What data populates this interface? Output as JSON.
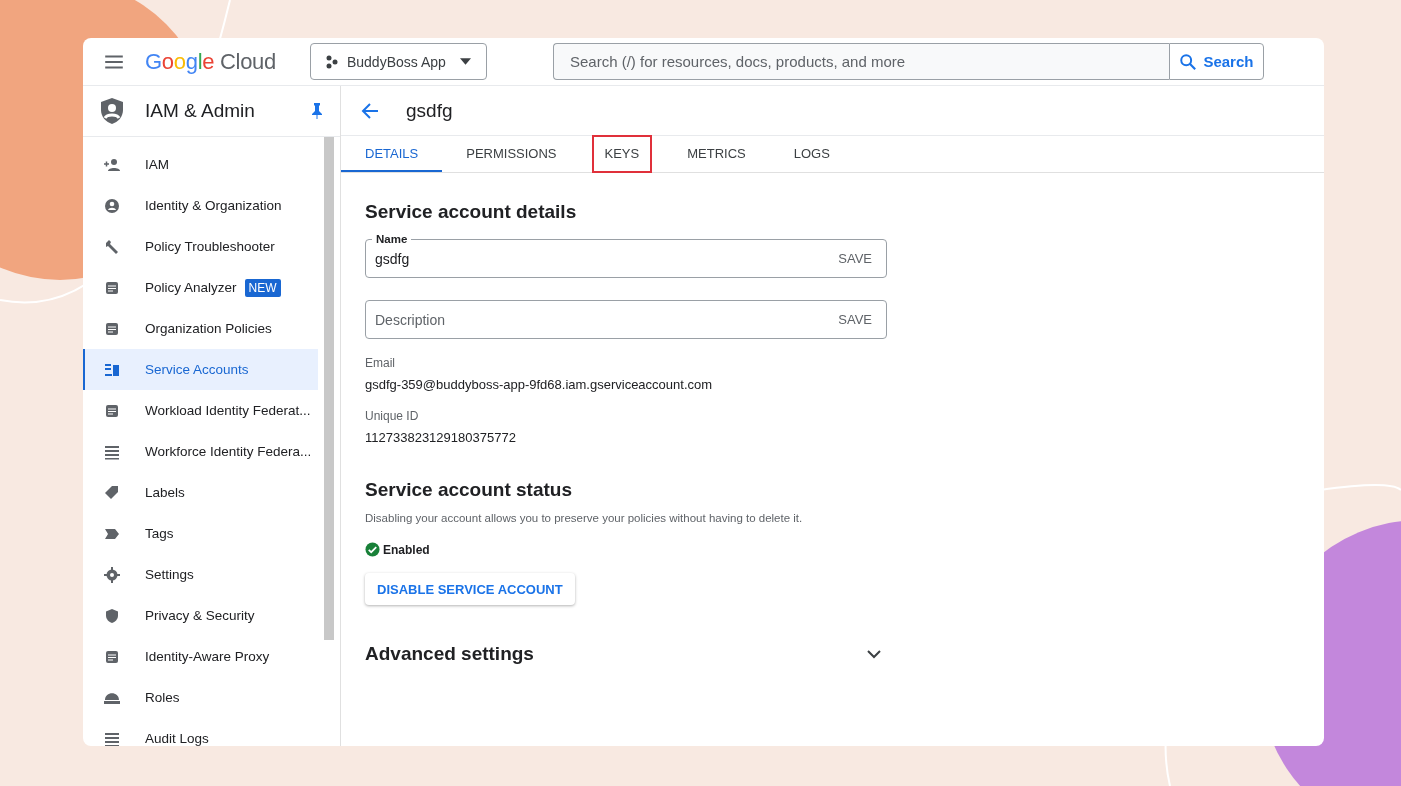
{
  "topbar": {
    "logo": {
      "google": "Google",
      "cloud": "Cloud"
    },
    "project": "BuddyBoss App",
    "search": {
      "placeholder": "Search (/) for resources, docs, products, and more",
      "button": "Search"
    }
  },
  "sidebar": {
    "title": "IAM & Admin",
    "items": [
      {
        "label": "IAM",
        "selected": false
      },
      {
        "label": "Identity & Organization",
        "selected": false
      },
      {
        "label": "Policy Troubleshooter",
        "selected": false
      },
      {
        "label": "Policy Analyzer",
        "badge": "NEW",
        "selected": false
      },
      {
        "label": "Organization Policies",
        "selected": false
      },
      {
        "label": "Service Accounts",
        "selected": true
      },
      {
        "label": "Workload Identity Federat...",
        "selected": false
      },
      {
        "label": "Workforce Identity Federa...",
        "selected": false
      },
      {
        "label": "Labels",
        "selected": false
      },
      {
        "label": "Tags",
        "selected": false
      },
      {
        "label": "Settings",
        "selected": false
      },
      {
        "label": "Privacy & Security",
        "selected": false
      },
      {
        "label": "Identity-Aware Proxy",
        "selected": false
      },
      {
        "label": "Roles",
        "selected": false
      },
      {
        "label": "Audit Logs",
        "selected": false
      }
    ]
  },
  "page": {
    "title": "gsdfg",
    "tabs": [
      {
        "label": "DETAILS",
        "selected": true,
        "highlighted": false
      },
      {
        "label": "PERMISSIONS",
        "selected": false,
        "highlighted": false
      },
      {
        "label": "KEYS",
        "selected": false,
        "highlighted": true
      },
      {
        "label": "METRICS",
        "selected": false,
        "highlighted": false
      },
      {
        "label": "LOGS",
        "selected": false,
        "highlighted": false
      }
    ]
  },
  "details": {
    "heading": "Service account details",
    "name_field": {
      "label": "Name",
      "value": "gsdfg",
      "action": "SAVE"
    },
    "description_field": {
      "placeholder": "Description",
      "action": "SAVE"
    },
    "email": {
      "label": "Email",
      "value": "gsdfg-359@buddyboss-app-9fd68.iam.gserviceaccount.com"
    },
    "unique_id": {
      "label": "Unique ID",
      "value": "112733823129180375772"
    }
  },
  "status": {
    "heading": "Service account status",
    "description": "Disabling your account allows you to preserve your policies without having to delete it.",
    "enabled": true,
    "state": "Enabled",
    "button": "DISABLE SERVICE ACCOUNT"
  },
  "advanced": {
    "heading": "Advanced settings",
    "expanded": false
  }
}
